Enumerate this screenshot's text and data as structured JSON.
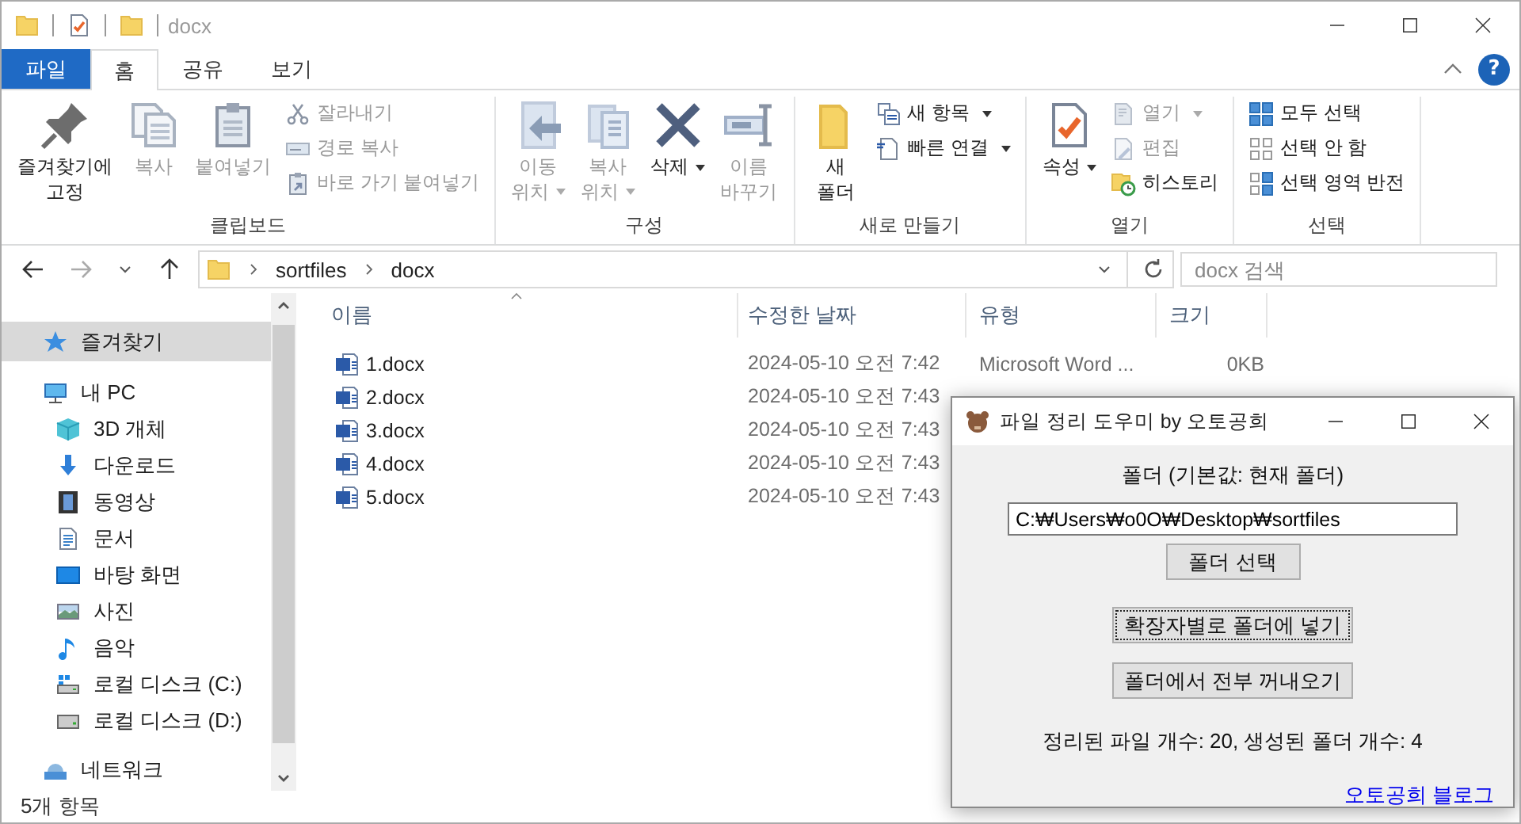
{
  "window": {
    "title": "docx"
  },
  "ribbon_tabs": [
    {
      "label": "파일",
      "kind": "file",
      "selected": false
    },
    {
      "label": "홈",
      "kind": "tab",
      "selected": true
    },
    {
      "label": "공유",
      "kind": "tab",
      "selected": false
    },
    {
      "label": "보기",
      "kind": "tab",
      "selected": false
    }
  ],
  "help_button": "?",
  "ribbon_groups": [
    {
      "title": "클립보드",
      "items": [
        {
          "kind": "pin",
          "label": "즐겨찾기에\n고정",
          "disabled": false,
          "dropdown": false
        },
        {
          "kind": "copy",
          "label": "복사",
          "disabled": true,
          "dropdown": false
        },
        {
          "kind": "paste",
          "label": "붙여넣기",
          "disabled": true,
          "dropdown": false
        },
        {
          "items": [
            {
              "kind": "cut",
              "label": "잘라내기",
              "disabled": true,
              "dropdown": false
            },
            {
              "kind": "copy-path",
              "label": "경로 복사",
              "disabled": true,
              "dropdown": false
            },
            {
              "kind": "paste-shortcut",
              "label": "바로 가기 붙여넣기",
              "disabled": true,
              "dropdown": false
            }
          ]
        }
      ]
    },
    {
      "title": "구성",
      "items": [
        {
          "kind": "move-to",
          "label": "이동\n위치",
          "disabled": true,
          "dropdown": true
        },
        {
          "kind": "copy-to",
          "label": "복사\n위치",
          "disabled": true,
          "dropdown": true
        },
        {
          "kind": "delete",
          "label": "삭제",
          "disabled": false,
          "dropdown": true
        },
        {
          "kind": "rename",
          "label": "이름\n바꾸기",
          "disabled": true,
          "dropdown": false
        }
      ]
    },
    {
      "title": "새로 만들기",
      "items": [
        {
          "kind": "new-folder",
          "label": "새\n폴더",
          "disabled": false,
          "dropdown": false
        },
        {
          "items": [
            {
              "kind": "new-item",
              "label": "새 항목",
              "disabled": false,
              "dropdown": true
            },
            {
              "kind": "easy-access",
              "label": "빠른 연결",
              "disabled": false,
              "dropdown": true
            }
          ]
        }
      ]
    },
    {
      "title": "열기",
      "items": [
        {
          "kind": "properties",
          "label": "속성",
          "disabled": false,
          "dropdown": true
        },
        {
          "items": [
            {
              "kind": "open",
              "label": "열기",
              "disabled": true,
              "dropdown": true
            },
            {
              "kind": "edit",
              "label": "편집",
              "disabled": true,
              "dropdown": false
            },
            {
              "kind": "history",
              "label": "히스토리",
              "disabled": false,
              "dropdown": false
            }
          ]
        }
      ]
    },
    {
      "title": "선택",
      "items": [
        {
          "items": [
            {
              "kind": "select-all",
              "label": "모두 선택",
              "disabled": false,
              "dropdown": false
            },
            {
              "kind": "select-none",
              "label": "선택 안 함",
              "disabled": false,
              "dropdown": false
            },
            {
              "kind": "invert",
              "label": "선택 영역 반전",
              "disabled": false,
              "dropdown": false
            }
          ]
        }
      ]
    }
  ],
  "address": {
    "path": [
      "sortfiles",
      "docx"
    ],
    "search": {
      "placeholder": "docx 검색"
    }
  },
  "sidebar": {
    "items": [
      {
        "kind": "star",
        "label": "즐겨찾기",
        "selected": true
      },
      {
        "kind": "pc",
        "label": "내 PC",
        "selected": false,
        "children": [
          {
            "kind": "cube",
            "label": "3D 개체",
            "selected": false
          },
          {
            "kind": "download",
            "label": "다운로드",
            "selected": false
          },
          {
            "kind": "film",
            "label": "동영상",
            "selected": false
          },
          {
            "kind": "doc",
            "label": "문서",
            "selected": false
          },
          {
            "kind": "desktop",
            "label": "바탕 화면",
            "selected": false
          },
          {
            "kind": "image",
            "label": "사진",
            "selected": false
          },
          {
            "kind": "music",
            "label": "음악",
            "selected": false
          },
          {
            "kind": "drive-c",
            "label": "로컬 디스크 (C:)",
            "selected": false
          },
          {
            "kind": "drive",
            "label": "로컬 디스크 (D:)",
            "selected": false
          }
        ]
      },
      {
        "kind": "network",
        "label": "네트워크",
        "selected": false
      }
    ]
  },
  "table": {
    "columns": [
      {
        "label": "이름",
        "sorted": true
      },
      {
        "label": "수정한 날짜",
        "sorted": false
      },
      {
        "label": "유형",
        "sorted": false
      },
      {
        "label": "크기",
        "sorted": false
      }
    ],
    "rows": [
      {
        "name": "1.docx",
        "date": "2024-05-10 오전 7:42",
        "type": "Microsoft Word ...",
        "size": "0KB"
      },
      {
        "name": "2.docx",
        "date": "2024-05-10 오전 7:43"
      },
      {
        "name": "3.docx",
        "date": "2024-05-10 오전 7:43"
      },
      {
        "name": "4.docx",
        "date": "2024-05-10 오전 7:43"
      },
      {
        "name": "5.docx",
        "date": "2024-05-10 오전 7:43"
      }
    ]
  },
  "status_bar": "5개 항목",
  "dialog": {
    "title": "파일 정리 도우미 by 오토공희",
    "folder_label": "폴더 (기본값: 현재 폴더)",
    "folder_value": "C:₩Users₩o0O₩Desktop₩sortfiles",
    "buttons": [
      {
        "label": "폴더 선택",
        "focused": false
      },
      {
        "label": "확장자별로 폴더에 넣기",
        "focused": true
      },
      {
        "label": "폴더에서 전부 꺼내오기",
        "focused": false
      }
    ],
    "result": "정리된 파일 개수: 20, 생성된 폴더 개수: 4",
    "link": "오토공희 블로그"
  }
}
